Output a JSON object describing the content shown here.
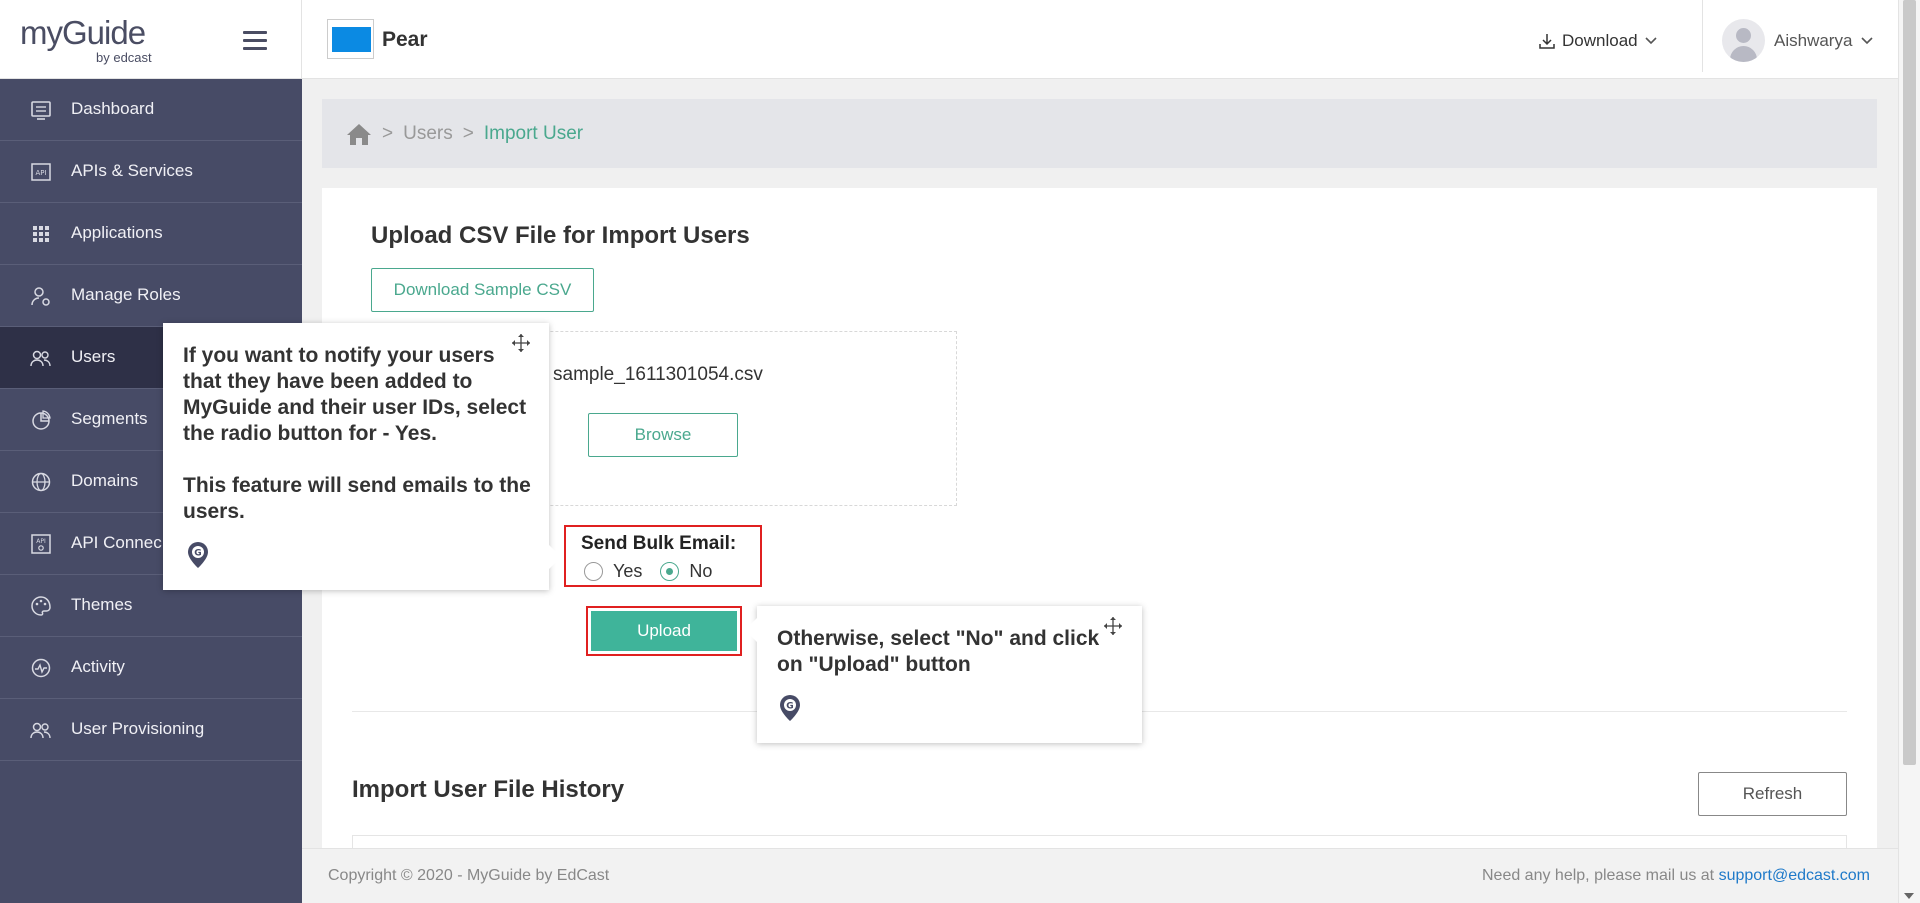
{
  "logo": {
    "main": "myGuide",
    "sub": "by edcast"
  },
  "header": {
    "app_name": "Pear",
    "app_color": "#0b8ae3",
    "download_label": "Download",
    "user_name": "Aishwarya"
  },
  "sidebar": {
    "items": [
      {
        "label": "Dashboard",
        "icon": "dashboard-icon"
      },
      {
        "label": "APIs & Services",
        "icon": "api-icon"
      },
      {
        "label": "Applications",
        "icon": "grid-icon"
      },
      {
        "label": "Manage Roles",
        "icon": "user-gear-icon"
      },
      {
        "label": "Users",
        "icon": "users-icon",
        "active": true
      },
      {
        "label": "Segments",
        "icon": "pie-icon"
      },
      {
        "label": "Domains",
        "icon": "globe-icon"
      },
      {
        "label": "API Connec",
        "icon": "api-connector-icon"
      },
      {
        "label": "Themes",
        "icon": "palette-icon"
      },
      {
        "label": "Activity",
        "icon": "activity-icon"
      },
      {
        "label": "User Provisioning",
        "icon": "users-icon"
      }
    ]
  },
  "breadcrumb": {
    "users": "Users",
    "current": "Import User"
  },
  "upload": {
    "title": "Upload CSV File for Import Users",
    "download_sample_label": "Download Sample CSV",
    "file_name": "sample_1611301054.csv",
    "browse_label": "Browse",
    "bulk_email_label": "Send Bulk Email:",
    "yes_label": "Yes",
    "no_label": "No",
    "selected": "No",
    "upload_label": "Upload"
  },
  "history": {
    "title": "Import User File History",
    "refresh_label": "Refresh"
  },
  "footer": {
    "copyright": "Copyright © 2020 - MyGuide by EdCast",
    "help_text": "Need any help, please mail us at",
    "email": "support@edcast.com"
  },
  "tooltips": {
    "tip1_line1": "If you want to notify your users that they have been added to MyGuide and their user IDs, select the radio button for - Yes.",
    "tip1_line2": "This feature will send emails to the users.",
    "tip2": "Otherwise, select \"No\" and click on \"Upload\" button"
  },
  "colors": {
    "accent": "#4aa88e",
    "upload_button": "#3fb49a",
    "sidebar": "#474b66",
    "highlight_border": "#e02020",
    "link": "#1f7ac9"
  }
}
